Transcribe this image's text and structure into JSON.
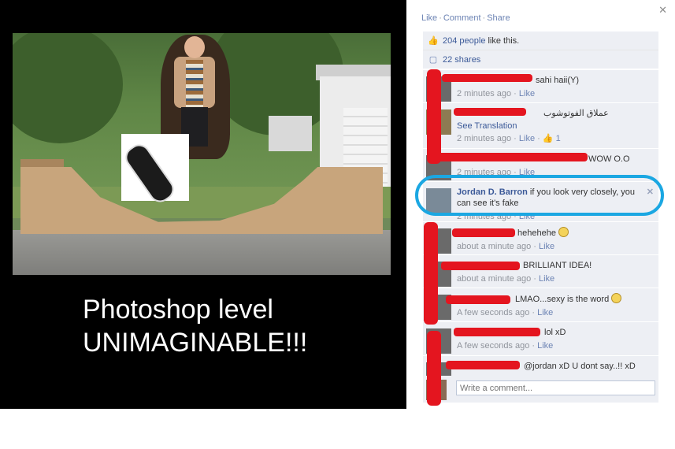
{
  "photo": {
    "caption_line1": "Photoshop level",
    "caption_line2": "UNIMAGINABLE!!!"
  },
  "panel": {
    "close_icon": "close-icon",
    "actions": {
      "like": "Like",
      "comment": "Comment",
      "share": "Share"
    },
    "likes": {
      "count_link": "204 people",
      "text": " like this."
    },
    "shares": {
      "count_link": "22 shares"
    },
    "comments": [
      {
        "text": "sahi haii(Y)",
        "time": "2 minutes ago",
        "like": "Like"
      },
      {
        "text": "عملاق الفوتوشوب",
        "translate": "See Translation",
        "time": "2 minutes ago",
        "like": "Like",
        "likes_count": "1"
      },
      {
        "text": "WOW O.O",
        "time": "2 minutes ago",
        "like": "Like"
      },
      {
        "author": "Jordan D. Barron",
        "text": "if you look very closely, you can see it's fake",
        "time": "2 minutes ago",
        "like": "Like"
      },
      {
        "text": "hehehehe",
        "time": "about a minute ago",
        "like": "Like"
      },
      {
        "text": "BRILLIANT IDEA!",
        "time": "about a minute ago",
        "like": "Like"
      },
      {
        "text": "LMAO...sexy is the word",
        "time": "A few seconds ago",
        "like": "Like"
      },
      {
        "text": "lol xD",
        "time": "A few seconds ago",
        "like": "Like"
      },
      {
        "text": "@jordan xD U dont say..!! xD",
        "time": "",
        "like": ""
      }
    ],
    "write_comment_placeholder": "Write a comment..."
  },
  "colors": {
    "highlight": "#1ba7e2",
    "redaction": "#e4151f",
    "link": "#3b5998"
  }
}
